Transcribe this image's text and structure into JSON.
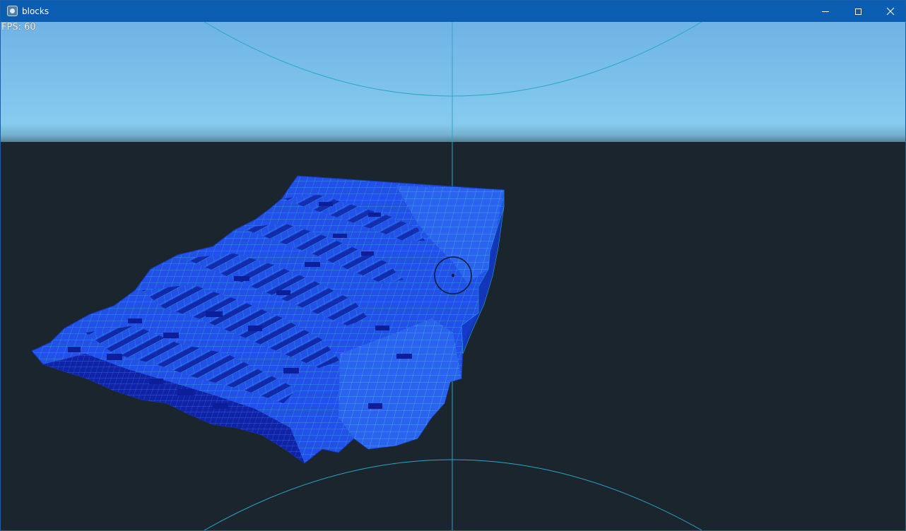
{
  "window": {
    "title": "blocks",
    "icon": "godot-engine-icon",
    "controls": {
      "minimize": "minimize-icon",
      "maximize": "maximize-icon",
      "close": "close-icon"
    }
  },
  "hud": {
    "fps_text": "FPS: 60"
  },
  "scene": {
    "sky_color_top": "#6fb3e6",
    "sky_color_horizon": "#87ccee",
    "ground_color": "#1b252d",
    "block_color": "#2148e0",
    "block_dark_color": "#0d1e9a",
    "grid_line_color": "#2bb0d0",
    "crosshair_icon": "crosshair-circle-icon"
  }
}
